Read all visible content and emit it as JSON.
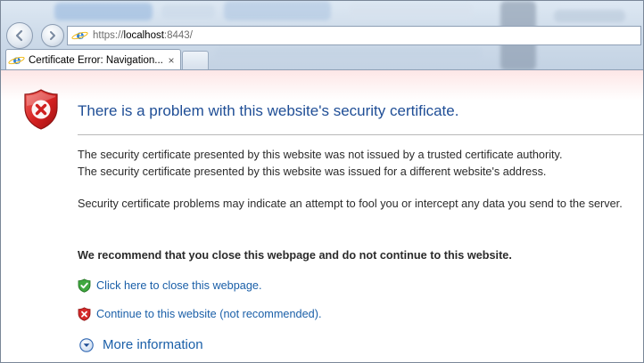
{
  "address_bar": {
    "scheme": "https://",
    "host": "localhost",
    "rest": ":8443/"
  },
  "tab": {
    "title": "Certificate Error: Navigation...",
    "close_glyph": "×"
  },
  "error_page": {
    "headline": "There is a problem with this website's security certificate.",
    "reason_1": "The security certificate presented by this website was not issued by a trusted certificate authority.",
    "reason_2": "The security certificate presented by this website was issued for a different website's address.",
    "warning": "Security certificate problems may indicate an attempt to fool you or intercept any data you send to the server.",
    "recommendation": "We recommend that you close this webpage and do not continue to this website.",
    "close_link": "Click here to close this webpage.",
    "continue_link": "Continue to this website (not recommended).",
    "more_info": "More information"
  },
  "icons": {
    "back": "back-arrow-icon",
    "forward": "forward-arrow-icon",
    "browser": "internet-explorer-icon",
    "error": "red-shield-x-icon",
    "safe": "green-shield-check-icon",
    "unsafe": "red-shield-x-icon",
    "expand": "chevron-down-circle-icon"
  },
  "colors": {
    "headline": "#1f4e96",
    "link": "#1a5fa8",
    "error_red": "#d32020",
    "safe_green": "#2e9a2e"
  }
}
